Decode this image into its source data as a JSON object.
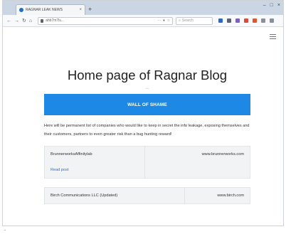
{
  "browser": {
    "tab_title": "RAGNAR LEAK NEWS",
    "tab_close": "×",
    "new_tab": "+",
    "window_controls": [
      "–",
      "□",
      "×"
    ],
    "nav": {
      "back": "←",
      "forward": "→",
      "reload": "↻",
      "home": "⌂"
    },
    "url": "ahb7m7ls...",
    "url_suffix_icons": [
      "⋯",
      "♦",
      "☆"
    ],
    "search_placeholder": "Search",
    "toolbar_icon_colors": [
      "#2f67c6",
      "#5a6470",
      "#7c5ec9",
      "#d84a3a",
      "#e0552b",
      "#8a9097",
      "#8a9097"
    ]
  },
  "page": {
    "title": "Home page of Ragnar Blog",
    "divider_glyph": "—",
    "wall_of_shame": "WALL OF SHAME",
    "description": "Here will be permanent list of companies who would like to keep in secret the info leakage, exposing themselves and their customers, partners to even greater risk than a bug hunting reward!",
    "cards": [
      {
        "name": "BrunnerworksAffinitylab",
        "site": "www.brunnerworks.com",
        "link": "Read post"
      },
      {
        "name": "Birch Communications LLC (Updated)",
        "site": "www.birch.com"
      }
    ]
  },
  "marker": "-"
}
